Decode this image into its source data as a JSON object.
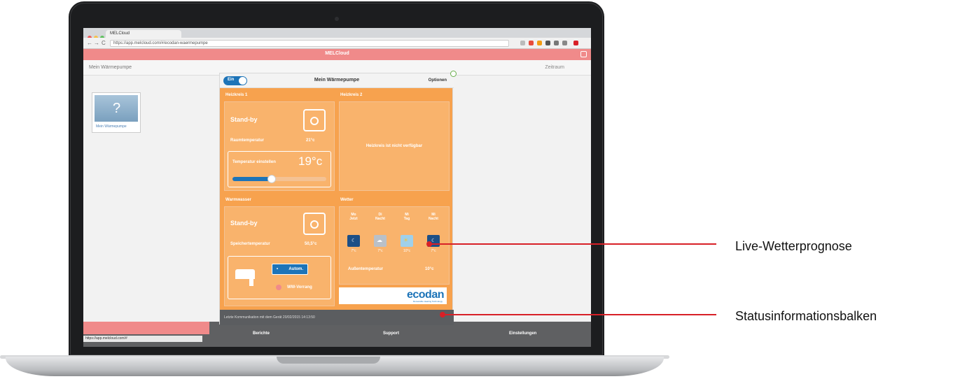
{
  "browser": {
    "tab_title": "MELCloud",
    "url": "https://app.melcloud.com/#/ecodan-waermepumpe"
  },
  "app": {
    "title": "MELCloud",
    "sub_left": "Mein Wärmepumpe",
    "sub_right": "Zeitraum",
    "device_card_label": "Mein Wärmepumpe",
    "bottom_nav": [
      "Berichte",
      "Support",
      "Einstellungen"
    ],
    "status_url": "https://app.melcloud.com/#"
  },
  "modal": {
    "toggle_label": "Ein",
    "title": "Mein Wärmepumpe",
    "options_label": "Optionen",
    "zone1": {
      "section": "Heizkreis 1",
      "state": "Stand-by",
      "room_temp_label": "Raumtemperatur",
      "room_temp_value": "21°c",
      "set_temp_label": "Temperatur einstellen",
      "set_temp_value": "19°c",
      "slider_level_percent": 42
    },
    "zone2": {
      "section": "Heizkreis 2",
      "message": "Heizkreis ist nicht verfügbar"
    },
    "hot_water": {
      "section": "Warmwasser",
      "state": "Stand-by",
      "tank_temp_label": "Speichertemperatur",
      "tank_temp_value": "50,5°c",
      "mode_button": "Autom.",
      "boost_label": "WW-Vorrang"
    },
    "weather": {
      "section": "Wetter",
      "columns": [
        {
          "day": "Mo",
          "time": "Jetzt",
          "icon": "moon-icon",
          "temp": "7°c"
        },
        {
          "day": "Di",
          "time": "Nacht",
          "icon": "cloud-icon",
          "temp": "7°c"
        },
        {
          "day": "Mi",
          "time": "Tag",
          "icon": "sun-cloud-icon",
          "temp": "10°c"
        },
        {
          "day": "Mi",
          "time": "Nacht",
          "icon": "moon-icon",
          "temp": "7°c"
        }
      ],
      "outdoor_label": "Außentemperatur",
      "outdoor_value": "10°c"
    },
    "brand": {
      "word": "ecodan",
      "tagline": "Renewable Heating Technology"
    },
    "status_text": "Letzte Kommunikation mit dem Gerät 20/02/2015 14:13:50"
  },
  "callouts": {
    "weather": "Live-Wetterprognose",
    "status": "Statusinformationsbalken"
  },
  "colors": {
    "accent_red": "#d82027",
    "orange": "#f7a24e",
    "blue": "#1d74b8"
  }
}
